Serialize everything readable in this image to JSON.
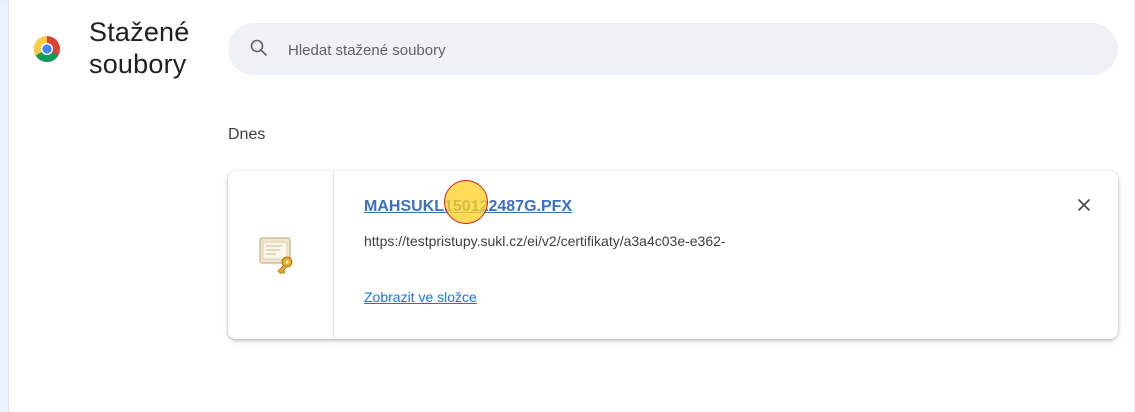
{
  "header": {
    "title_line1": "Stažené",
    "title_line2": "soubory"
  },
  "search": {
    "placeholder": "Hledat stažené soubory",
    "value": ""
  },
  "downloads": {
    "section_label": "Dnes",
    "items": [
      {
        "file_name": "MAHSUKL150122487G.PFX",
        "url": "https://testpristupy.sukl.cz/ei/v2/certifikaty/a3a4c03e-e362-",
        "action_label": "Zobrazit ve složce"
      }
    ]
  },
  "icons": {
    "browser": "chrome-logo-icon",
    "search": "search-icon",
    "file": "certificate-file-icon",
    "remove": "close-icon"
  },
  "colors": {
    "link_blue": "#1a73e8",
    "file_name_blue": "#3a6fc1",
    "click_highlight": "#ffd228",
    "click_ring": "#d81b1b"
  }
}
